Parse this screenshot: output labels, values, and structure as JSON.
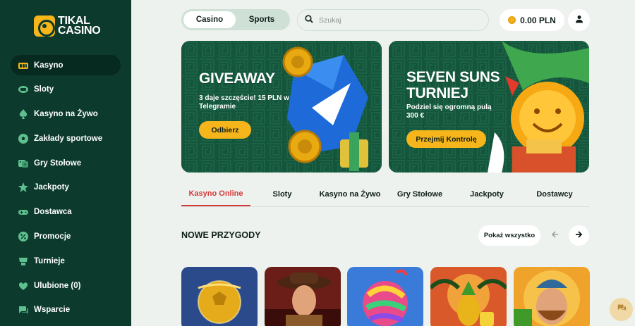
{
  "brand": {
    "line1": "TIKAL",
    "line2": "CASINO"
  },
  "sidebar": {
    "items": [
      {
        "label": "Kasyno",
        "icon": "cards-icon",
        "active": true
      },
      {
        "label": "Sloty",
        "icon": "slot-icon"
      },
      {
        "label": "Kasyno na Żywo",
        "icon": "spade-icon"
      },
      {
        "label": "Zakłady sportowe",
        "icon": "ball-icon"
      },
      {
        "label": "Gry Stołowe",
        "icon": "dice-icon"
      },
      {
        "label": "Jackpoty",
        "icon": "star-icon"
      },
      {
        "label": "Dostawca",
        "icon": "gamepad-icon"
      },
      {
        "label": "Promocje",
        "icon": "percent-icon"
      },
      {
        "label": "Turnieje",
        "icon": "trophy-icon"
      },
      {
        "label": "Ulubione (0)",
        "icon": "heart-icon"
      },
      {
        "label": "Wsparcie",
        "icon": "chat-icon"
      }
    ]
  },
  "header": {
    "switch": [
      "Casino",
      "Sports"
    ],
    "search_placeholder": "Szukaj",
    "balance": "0.00 PLN"
  },
  "banners": [
    {
      "title_lines": [
        "GIVEAWAY"
      ],
      "subtitle": "3 daje szczęście! 15 PLN w Telegramie",
      "button": "Odbierz"
    },
    {
      "title_lines": [
        "SEVEN SUNS",
        "TURNIEJ"
      ],
      "subtitle": "Podziel się ogromną pulą 300 €",
      "button": "Przejmij Kontrolę"
    }
  ],
  "tabs": [
    "Kasyno Online",
    "Sloty",
    "Kasyno na Żywo",
    "Gry Stołowe",
    "Jackpoty",
    "Dostawcy"
  ],
  "section": {
    "title": "NOWE PRZYGODY",
    "show_all": "Pokaż wszystko"
  },
  "colors": {
    "sidebar": "#0c3a2c",
    "accent": "#f6b51a",
    "active_tab": "#d63a3a"
  }
}
